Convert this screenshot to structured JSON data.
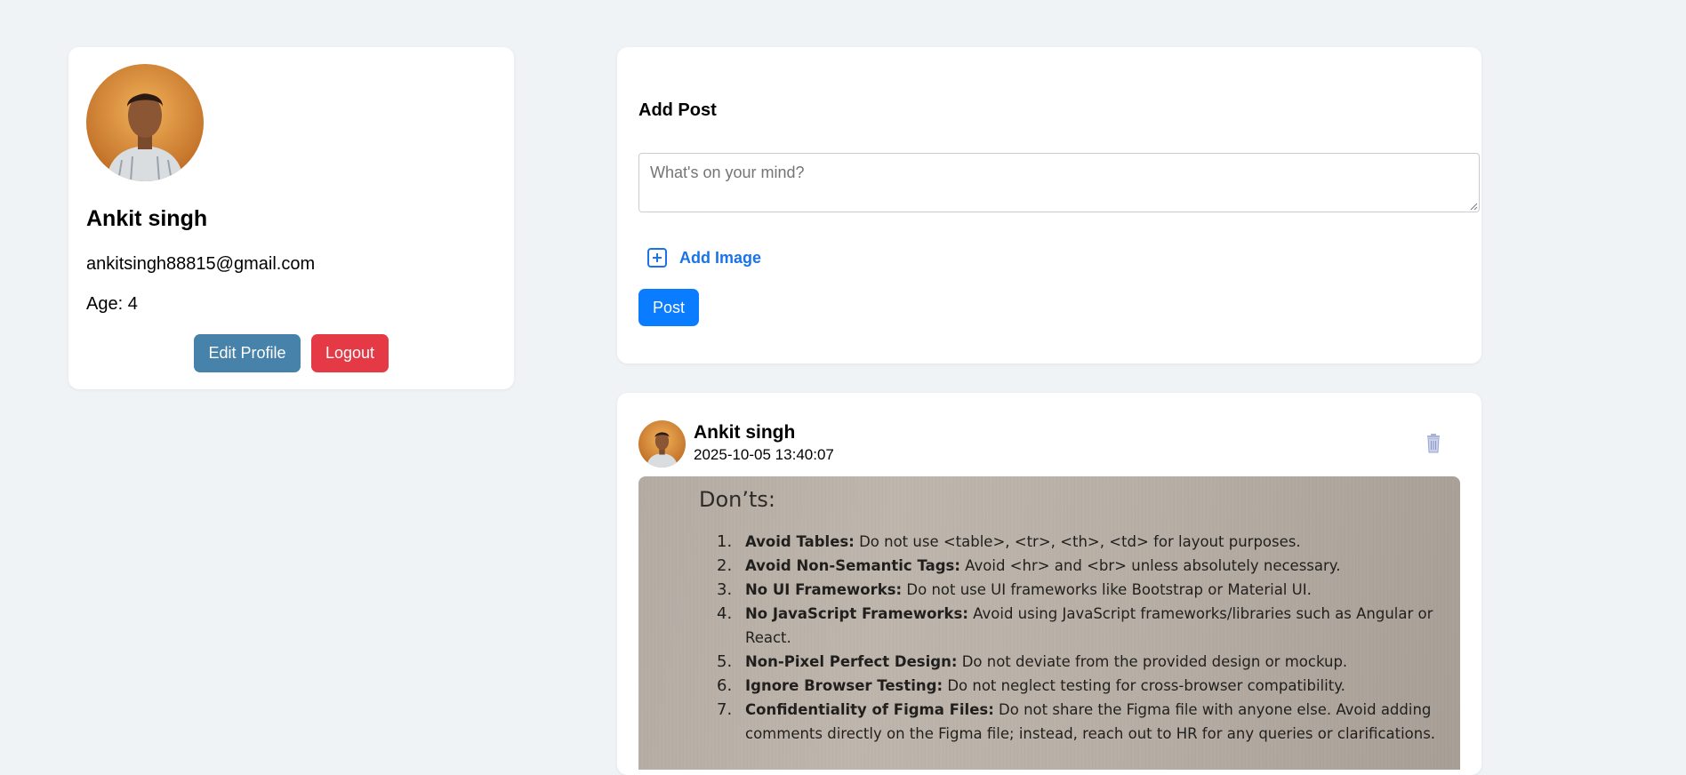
{
  "profile": {
    "name": "Ankit singh",
    "email": "ankitsingh88815@gmail.com",
    "age": "Age: 4",
    "edit_label": "Edit Profile",
    "logout_label": "Logout"
  },
  "add_post": {
    "title": "Add Post",
    "placeholder": "What's on your mind?",
    "add_image_label": "Add Image",
    "post_label": "Post"
  },
  "post": {
    "author": "Ankit singh",
    "timestamp": "2025-10-05 13:40:07",
    "image_text": {
      "heading": "Don’ts:",
      "items": [
        {
          "num": "1.",
          "bold": "Avoid Tables:",
          "text": " Do not use <table>, <tr>, <th>, <td> for layout purposes."
        },
        {
          "num": "2.",
          "bold": "Avoid Non-Semantic Tags:",
          "text": " Avoid <hr> and <br> unless absolutely necessary."
        },
        {
          "num": "3.",
          "bold": "No UI Frameworks:",
          "text": " Do not use UI frameworks like Bootstrap or Material UI."
        },
        {
          "num": "4.",
          "bold": "No JavaScript Frameworks:",
          "text": " Avoid using JavaScript frameworks/libraries such as Angular or React."
        },
        {
          "num": "5.",
          "bold": "Non-Pixel Perfect Design:",
          "text": " Do not deviate from the provided design or mockup."
        },
        {
          "num": "6.",
          "bold": "Ignore Browser Testing:",
          "text": " Do not neglect testing for cross-browser compatibility."
        },
        {
          "num": "7.",
          "bold": "Confidentiality of Figma Files:",
          "text": " Do not share the Figma file with anyone else. Avoid adding comments directly on the Figma file; instead, reach out to HR for any queries or clarifications."
        }
      ]
    }
  },
  "colors": {
    "edit_button": "#4682a9",
    "logout_button": "#e63946",
    "post_button": "#0a7cff",
    "link": "#1a73e8",
    "background": "#f0f3f6"
  },
  "icons": [
    "add-image-icon",
    "trash-icon",
    "resize-grip-icon"
  ]
}
